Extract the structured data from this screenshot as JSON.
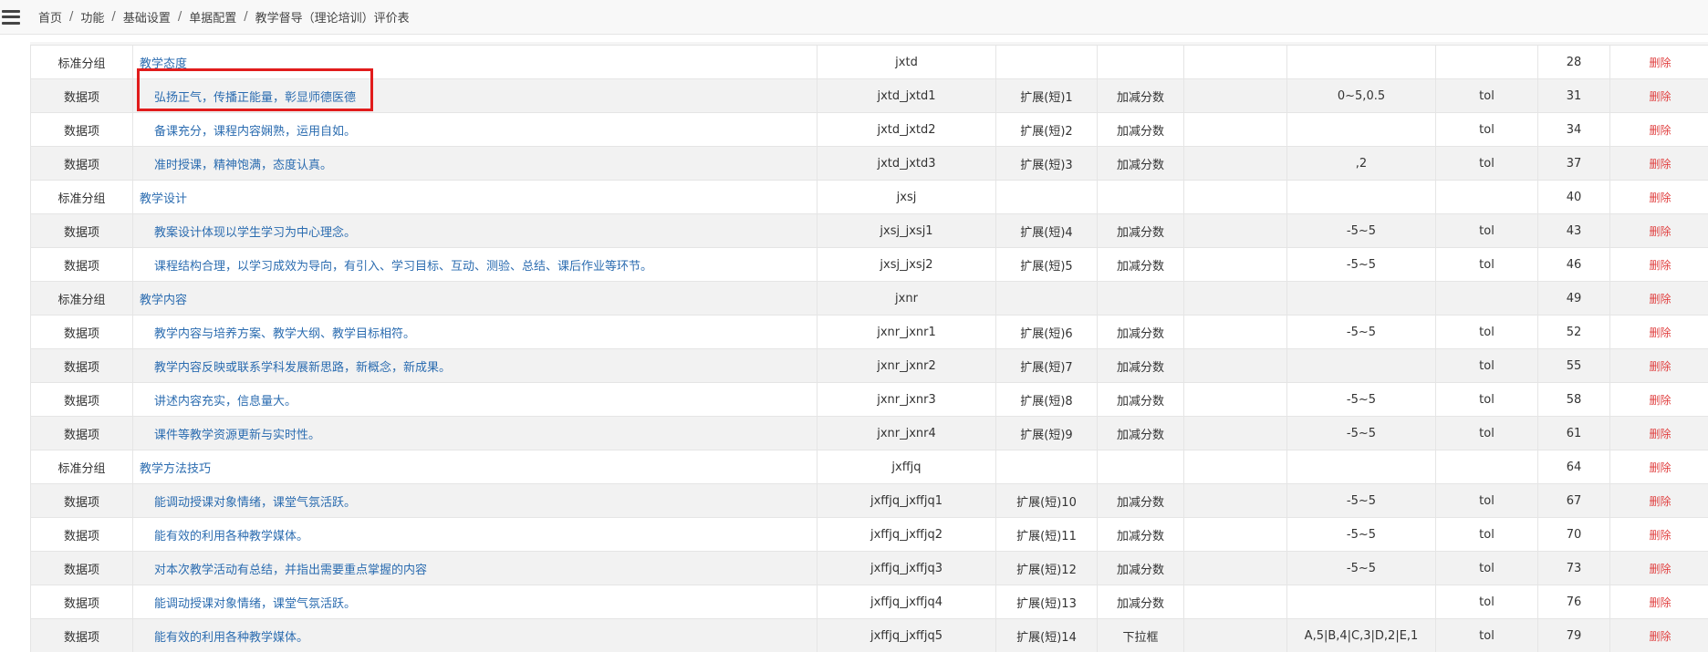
{
  "breadcrumb": [
    "首页",
    "功能",
    "基础设置",
    "单据配置",
    "教学督导（理论培训）评价表"
  ],
  "icons": {
    "menu": "hamburger-menu-icon"
  },
  "colors": {
    "link": "#2b6cb0",
    "delete": "#e04040",
    "highlight": "#e11c1c"
  },
  "delete_label": "删除",
  "rows": [
    {
      "type": "标准分组",
      "name": "教学态度",
      "code": "jxtd",
      "field": "",
      "input": "",
      "range": "",
      "tol": "",
      "order": "28"
    },
    {
      "type": "数据项",
      "name": "弘扬正气，传播正能量，彰显师德医德",
      "code": "jxtd_jxtd1",
      "field": "扩展(短)1",
      "input": "加减分数",
      "range": "0~5,0.5",
      "tol": "tol",
      "order": "31"
    },
    {
      "type": "数据项",
      "name": "备课充分，课程内容娴熟，运用自如。",
      "code": "jxtd_jxtd2",
      "field": "扩展(短)2",
      "input": "加减分数",
      "range": "",
      "tol": "tol",
      "order": "34"
    },
    {
      "type": "数据项",
      "name": "准时授课，精神饱满，态度认真。",
      "code": "jxtd_jxtd3",
      "field": "扩展(短)3",
      "input": "加减分数",
      "range": ",2",
      "tol": "tol",
      "order": "37"
    },
    {
      "type": "标准分组",
      "name": "教学设计",
      "code": "jxsj",
      "field": "",
      "input": "",
      "range": "",
      "tol": "",
      "order": "40"
    },
    {
      "type": "数据项",
      "name": "教案设计体现以学生学习为中心理念。",
      "code": "jxsj_jxsj1",
      "field": "扩展(短)4",
      "input": "加减分数",
      "range": "-5~5",
      "tol": "tol",
      "order": "43"
    },
    {
      "type": "数据项",
      "name": "课程结构合理，以学习成效为导向，有引入、学习目标、互动、测验、总结、课后作业等环节。",
      "code": "jxsj_jxsj2",
      "field": "扩展(短)5",
      "input": "加减分数",
      "range": "-5~5",
      "tol": "tol",
      "order": "46"
    },
    {
      "type": "标准分组",
      "name": "教学内容",
      "code": "jxnr",
      "field": "",
      "input": "",
      "range": "",
      "tol": "",
      "order": "49"
    },
    {
      "type": "数据项",
      "name": "教学内容与培养方案、教学大纲、教学目标相符。",
      "code": "jxnr_jxnr1",
      "field": "扩展(短)6",
      "input": "加减分数",
      "range": "-5~5",
      "tol": "tol",
      "order": "52"
    },
    {
      "type": "数据项",
      "name": "教学内容反映或联系学科发展新思路，新概念，新成果。",
      "code": "jxnr_jxnr2",
      "field": "扩展(短)7",
      "input": "加减分数",
      "range": "",
      "tol": "tol",
      "order": "55"
    },
    {
      "type": "数据项",
      "name": "讲述内容充实，信息量大。",
      "code": "jxnr_jxnr3",
      "field": "扩展(短)8",
      "input": "加减分数",
      "range": "-5~5",
      "tol": "tol",
      "order": "58"
    },
    {
      "type": "数据项",
      "name": "课件等教学资源更新与实时性。",
      "code": "jxnr_jxnr4",
      "field": "扩展(短)9",
      "input": "加减分数",
      "range": "-5~5",
      "tol": "tol",
      "order": "61"
    },
    {
      "type": "标准分组",
      "name": "教学方法技巧",
      "code": "jxffjq",
      "field": "",
      "input": "",
      "range": "",
      "tol": "",
      "order": "64"
    },
    {
      "type": "数据项",
      "name": "能调动授课对象情绪，课堂气氛活跃。",
      "code": "jxffjq_jxffjq1",
      "field": "扩展(短)10",
      "input": "加减分数",
      "range": "-5~5",
      "tol": "tol",
      "order": "67"
    },
    {
      "type": "数据项",
      "name": "能有效的利用各种教学媒体。",
      "code": "jxffjq_jxffjq2",
      "field": "扩展(短)11",
      "input": "加减分数",
      "range": "-5~5",
      "tol": "tol",
      "order": "70"
    },
    {
      "type": "数据项",
      "name": "对本次教学活动有总结，并指出需要重点掌握的内容",
      "code": "jxffjq_jxffjq3",
      "field": "扩展(短)12",
      "input": "加减分数",
      "range": "-5~5",
      "tol": "tol",
      "order": "73"
    },
    {
      "type": "数据项",
      "name": "能调动授课对象情绪，课堂气氛活跃。",
      "code": "jxffjq_jxffjq4",
      "field": "扩展(短)13",
      "input": "加减分数",
      "range": "",
      "tol": "tol",
      "order": "76"
    },
    {
      "type": "数据项",
      "name": "能有效的利用各种教学媒体。",
      "code": "jxffjq_jxffjq5",
      "field": "扩展(短)14",
      "input": "下拉框",
      "range": "A,5|B,4|C,3|D,2|E,1",
      "tol": "tol",
      "order": "79"
    }
  ]
}
